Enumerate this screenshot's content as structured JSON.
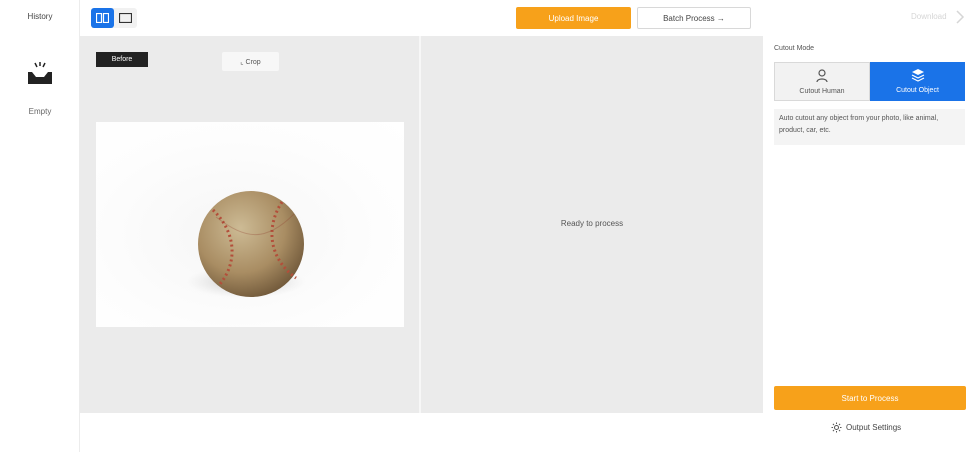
{
  "history": {
    "title": "History",
    "empty_label": "Empty",
    "icon": "inbox-icon"
  },
  "toolbar": {
    "upload_label": "Upload Image",
    "batch_label": "Batch Process →",
    "view_modes": [
      "split-view-icon",
      "single-view-icon"
    ]
  },
  "canvas": {
    "before_label": "Before",
    "crop_label": "⌞ Crop",
    "photo_subject": "baseball",
    "ready_text": "Ready to process"
  },
  "panel": {
    "download_label": "Download",
    "mode_title": "Cutout Mode",
    "modes": [
      {
        "label": "Cutout Human",
        "icon": "person-icon",
        "selected": false
      },
      {
        "label": "Cutout Object",
        "icon": "layers-icon",
        "selected": true
      }
    ],
    "description": "Auto cutout any object from your photo, like animal, product, car, etc.",
    "start_label": "Start to Process",
    "output_settings_label": "Output Settings"
  },
  "colors": {
    "accent_orange": "#f7a11a",
    "accent_blue": "#1a73e8",
    "canvas_bg": "#ebebeb"
  }
}
